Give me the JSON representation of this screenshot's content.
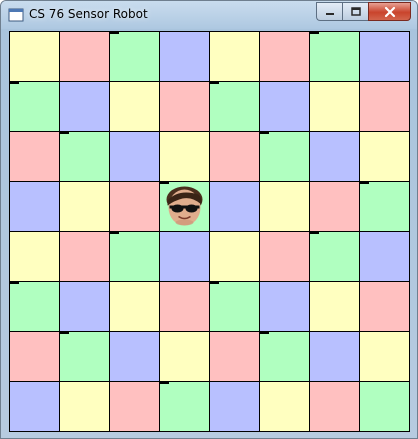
{
  "window": {
    "title": "CS 76 Sensor Robot",
    "icon": "application-window-icon",
    "controls": {
      "minimize_icon": "minimize-icon",
      "maximize_icon": "maximize-icon",
      "close_icon": "close-icon"
    }
  },
  "colors": {
    "yellow": "#ffffc0",
    "red": "#ffc0c0",
    "green": "#b0ffc0",
    "blue": "#b8c0ff",
    "grid_line": "#000000",
    "wall_marker": "#000000"
  },
  "board": {
    "rows": 8,
    "cols": 8,
    "tiles": [
      [
        "yellow",
        "red",
        "green",
        "blue",
        "yellow",
        "red",
        "green",
        "blue"
      ],
      [
        "green",
        "blue",
        "yellow",
        "red",
        "green",
        "blue",
        "yellow",
        "red"
      ],
      [
        "red",
        "green",
        "blue",
        "yellow",
        "red",
        "green",
        "blue",
        "yellow"
      ],
      [
        "blue",
        "yellow",
        "red",
        "green",
        "blue",
        "yellow",
        "red",
        "green"
      ],
      [
        "yellow",
        "red",
        "green",
        "blue",
        "yellow",
        "red",
        "green",
        "blue"
      ],
      [
        "green",
        "blue",
        "yellow",
        "red",
        "green",
        "blue",
        "yellow",
        "red"
      ],
      [
        "red",
        "green",
        "blue",
        "yellow",
        "red",
        "green",
        "blue",
        "yellow"
      ],
      [
        "blue",
        "yellow",
        "red",
        "green",
        "blue",
        "yellow",
        "red",
        "green"
      ]
    ],
    "markers": [
      {
        "row": 0,
        "col": 2
      },
      {
        "row": 0,
        "col": 6
      },
      {
        "row": 1,
        "col": 0
      },
      {
        "row": 1,
        "col": 4
      },
      {
        "row": 2,
        "col": 1
      },
      {
        "row": 2,
        "col": 5
      },
      {
        "row": 3,
        "col": 3
      },
      {
        "row": 3,
        "col": 7
      },
      {
        "row": 4,
        "col": 2
      },
      {
        "row": 4,
        "col": 6
      },
      {
        "row": 5,
        "col": 0
      },
      {
        "row": 5,
        "col": 4
      },
      {
        "row": 6,
        "col": 1
      },
      {
        "row": 6,
        "col": 5
      },
      {
        "row": 7,
        "col": 3
      }
    ],
    "robot": {
      "row": 3,
      "col": 3,
      "icon": "robot-face-icon"
    }
  }
}
